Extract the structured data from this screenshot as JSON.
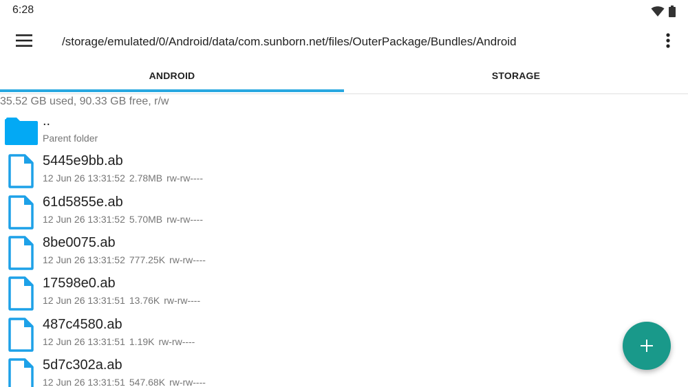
{
  "status_bar": {
    "time": "6:28",
    "icons": [
      "wifi-icon",
      "battery-icon"
    ]
  },
  "app_bar": {
    "menu_icon": "menu-icon",
    "path": "/storage/emulated/0/Android/data/com.sunborn.net/files/OuterPackage/Bundles/Android",
    "overflow_icon": "more-vert-icon"
  },
  "tabs": [
    {
      "label": "ANDROID",
      "selected": true
    },
    {
      "label": "STORAGE",
      "selected": false
    }
  ],
  "storage_info": "35.52 GB used, 90.33 GB free, r/w",
  "parent_folder": {
    "name": "..",
    "subtitle": "Parent folder",
    "icon": "folder-icon"
  },
  "files": [
    {
      "name": "5445e9bb.ab",
      "date": "12 Jun 26 13:31:52",
      "size": "2.78MB",
      "perms": "rw-rw----",
      "icon": "file-icon"
    },
    {
      "name": "61d5855e.ab",
      "date": "12 Jun 26 13:31:52",
      "size": "5.70MB",
      "perms": "rw-rw----",
      "icon": "file-icon"
    },
    {
      "name": "8be0075.ab",
      "date": "12 Jun 26 13:31:52",
      "size": "777.25K",
      "perms": "rw-rw----",
      "icon": "file-icon"
    },
    {
      "name": "17598e0.ab",
      "date": "12 Jun 26 13:31:51",
      "size": "13.76K",
      "perms": "rw-rw----",
      "icon": "file-icon"
    },
    {
      "name": "487c4580.ab",
      "date": "12 Jun 26 13:31:51",
      "size": "1.19K",
      "perms": "rw-rw----",
      "icon": "file-icon"
    },
    {
      "name": "5d7c302a.ab",
      "date": "12 Jun 26 13:31:51",
      "size": "547.68K",
      "perms": "rw-rw----",
      "icon": "file-icon"
    }
  ],
  "fab": {
    "icon": "add-icon"
  },
  "colors": {
    "accent": "#29a8e0",
    "folder": "#03a9f4",
    "file_outline": "#1da1e8",
    "fab": "#19998a"
  }
}
